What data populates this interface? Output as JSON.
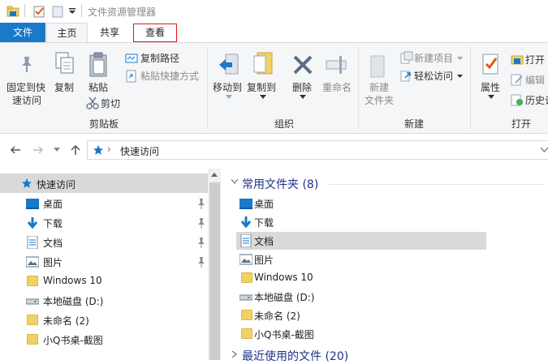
{
  "window": {
    "title": "文件资源管理器"
  },
  "tabs": {
    "file": "文件",
    "home": "主页",
    "share": "共享",
    "view": "查看"
  },
  "ribbon": {
    "clipboard": {
      "pin_label_1": "固定到快",
      "pin_label_2": "速访问",
      "copy": "复制",
      "paste": "粘贴",
      "copy_path": "复制路径",
      "paste_shortcut": "粘贴快捷方式",
      "cut": "剪切",
      "group": "剪贴板"
    },
    "organize": {
      "move_to": "移动到",
      "copy_to": "复制到",
      "delete": "删除",
      "rename": "重命名",
      "group": "组织"
    },
    "new": {
      "new_folder_1": "新建",
      "new_folder_2": "文件夹",
      "new_item": "新建项目",
      "easy_access": "轻松访问",
      "group": "新建"
    },
    "open": {
      "properties": "属性",
      "open": "打开",
      "edit": "编辑",
      "history": "历史记",
      "group": "打开"
    }
  },
  "address": {
    "path": "快速访问"
  },
  "nav": {
    "quick_access": "快速访问",
    "items": [
      {
        "label": "桌面",
        "pinned": true
      },
      {
        "label": "下载",
        "pinned": true
      },
      {
        "label": "文档",
        "pinned": true
      },
      {
        "label": "图片",
        "pinned": true
      },
      {
        "label": "Windows 10",
        "pinned": false
      },
      {
        "label": "本地磁盘 (D:)",
        "pinned": false
      },
      {
        "label": "未命名 (2)",
        "pinned": false
      },
      {
        "label": "小Q书桌-截图",
        "pinned": false
      }
    ]
  },
  "content": {
    "frequent_header": "常用文件夹 (8)",
    "recent_header": "最近使用的文件 (20)",
    "items": [
      "桌面",
      "下载",
      "文档",
      "图片",
      "Windows 10",
      "本地磁盘 (D:)",
      "未命名 (2)",
      "小Q书桌-截图"
    ]
  },
  "colors": {
    "accent": "#1979ca",
    "highlight_border": "#e81123",
    "folder": "#f0d264"
  }
}
